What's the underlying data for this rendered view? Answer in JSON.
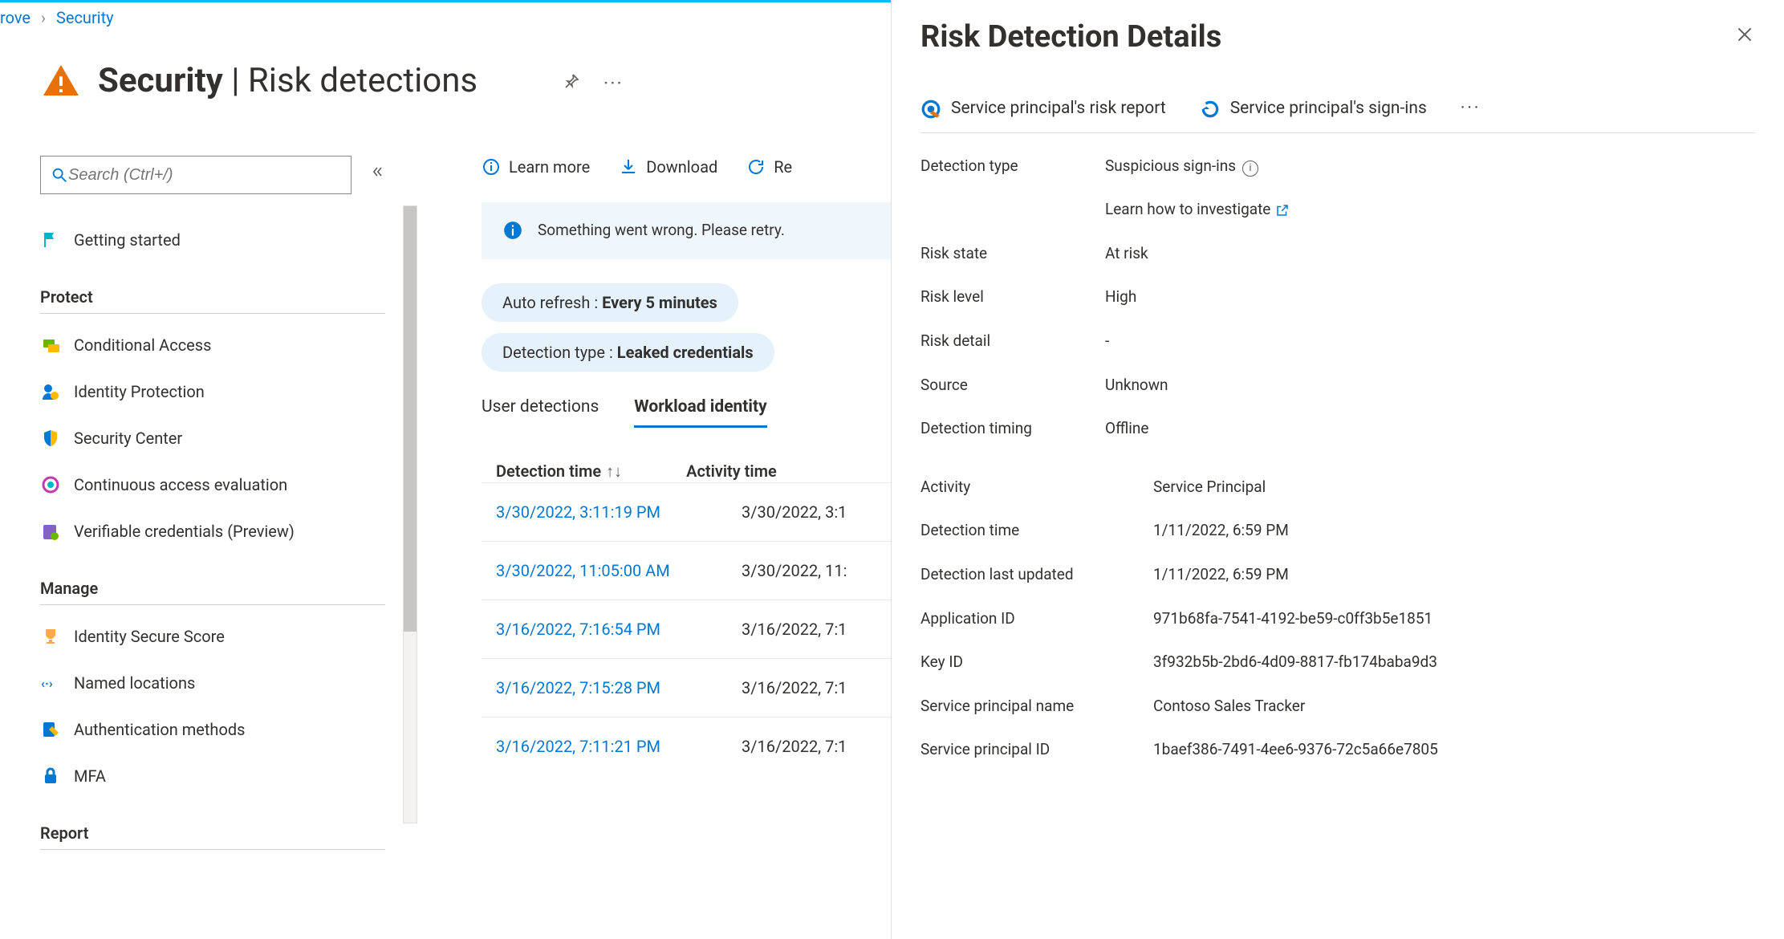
{
  "breadcrumb": {
    "parent_fragment": "rove",
    "current": "Security"
  },
  "header": {
    "title_strong": "Security",
    "title_sep": " | ",
    "title_light": "Risk detections"
  },
  "search": {
    "placeholder": "Search (Ctrl+/)"
  },
  "sidebar": {
    "getting_started": "Getting started",
    "sections": {
      "protect": {
        "title": "Protect",
        "items": [
          "Conditional Access",
          "Identity Protection",
          "Security Center",
          "Continuous access evaluation",
          "Verifiable credentials (Preview)"
        ]
      },
      "manage": {
        "title": "Manage",
        "items": [
          "Identity Secure Score",
          "Named locations",
          "Authentication methods",
          "MFA"
        ]
      },
      "report": {
        "title": "Report"
      }
    }
  },
  "toolbar": {
    "learn_more": "Learn more",
    "download": "Download",
    "refresh_fragment": "Re"
  },
  "banner": {
    "text": "Something went wrong. Please retry."
  },
  "filters": {
    "auto_refresh": {
      "label": "Auto refresh : ",
      "value": "Every 5 minutes"
    },
    "detection_type": {
      "label": "Detection type : ",
      "value": "Leaked credentials"
    }
  },
  "tabs": {
    "user": "User detections",
    "workload": "Workload identity"
  },
  "table": {
    "columns": {
      "detection_time": "Detection time",
      "activity_time": "Activity time"
    },
    "sort_glyph": "↑↓",
    "rows": [
      {
        "detection": "3/30/2022, 3:11:19 PM",
        "activity": "3/30/2022, 3:1"
      },
      {
        "detection": "3/30/2022, 11:05:00 AM",
        "activity": "3/30/2022, 11:"
      },
      {
        "detection": "3/16/2022, 7:16:54 PM",
        "activity": "3/16/2022, 7:1"
      },
      {
        "detection": "3/16/2022, 7:15:28 PM",
        "activity": "3/16/2022, 7:1"
      },
      {
        "detection": "3/16/2022, 7:11:21 PM",
        "activity": "3/16/2022, 7:1"
      }
    ]
  },
  "panel": {
    "title": "Risk Detection Details",
    "actions": {
      "risk_report": "Service principal's risk report",
      "signins": "Service principal's sign-ins",
      "more": "···"
    },
    "fields1": [
      {
        "k": "Detection type",
        "v": "Suspicious sign-ins",
        "info": true
      },
      {
        "k": "",
        "v": "Learn how to investigate",
        "link": true,
        "external": true
      },
      {
        "k": "Risk state",
        "v": "At risk"
      },
      {
        "k": "Risk level",
        "v": "High"
      },
      {
        "k": "Risk detail",
        "v": "-"
      },
      {
        "k": "Source",
        "v": "Unknown"
      },
      {
        "k": "Detection timing",
        "v": "Offline"
      }
    ],
    "fields2": [
      {
        "k": "Activity",
        "v": "Service Principal"
      },
      {
        "k": "Detection time",
        "v": "1/11/2022, 6:59 PM"
      },
      {
        "k": "Detection last updated",
        "v": "1/11/2022, 6:59 PM"
      },
      {
        "k": "Application ID",
        "v": "971b68fa-7541-4192-be59-c0ff3b5e1851"
      },
      {
        "k": "Key ID",
        "v": "3f932b5b-2bd6-4d09-8817-fb174baba9d3"
      },
      {
        "k": "Service principal name",
        "v": "Contoso Sales Tracker"
      },
      {
        "k": "Service principal ID",
        "v": "1baef386-7491-4ee6-9376-72c5a66e7805"
      }
    ]
  }
}
